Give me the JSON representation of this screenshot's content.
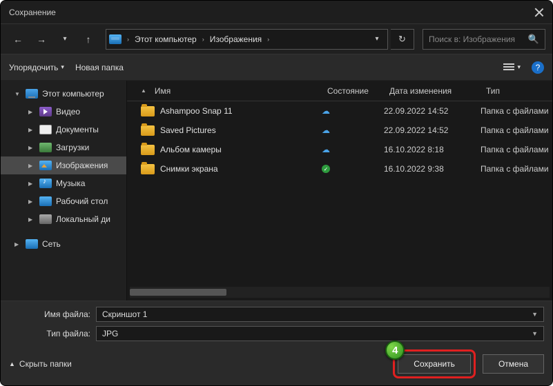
{
  "title": "Сохранение",
  "breadcrumb": {
    "root": "Этот компьютер",
    "folder": "Изображения"
  },
  "search": {
    "placeholder": "Поиск в: Изображения"
  },
  "toolbar": {
    "organize": "Упорядочить",
    "newfolder": "Новая папка"
  },
  "sidebar": {
    "pc": "Этот компьютер",
    "video": "Видео",
    "docs": "Документы",
    "downloads": "Загрузки",
    "images": "Изображения",
    "music": "Музыка",
    "desktop": "Рабочий стол",
    "disk": "Локальный ди",
    "net": "Сеть"
  },
  "columns": {
    "name": "Имя",
    "state": "Состояние",
    "date": "Дата изменения",
    "type": "Тип"
  },
  "rows": [
    {
      "name": "Ashampoo Snap 11",
      "state": "cloud",
      "date": "22.09.2022 14:52",
      "type": "Папка с файлами"
    },
    {
      "name": "Saved Pictures",
      "state": "cloud",
      "date": "22.09.2022 14:52",
      "type": "Папка с файлами"
    },
    {
      "name": "Альбом камеры",
      "state": "cloud",
      "date": "16.10.2022 8:18",
      "type": "Папка с файлами"
    },
    {
      "name": "Снимки экрана",
      "state": "check",
      "date": "16.10.2022 9:38",
      "type": "Папка с файлами"
    }
  ],
  "form": {
    "filename_label": "Имя файла:",
    "filename_value": "Скриншот 1",
    "filetype_label": "Тип файла:",
    "filetype_value": "JPG",
    "hide_folders": "Скрыть папки",
    "save": "Сохранить",
    "cancel": "Отмена"
  },
  "annotation": {
    "step": "4"
  }
}
